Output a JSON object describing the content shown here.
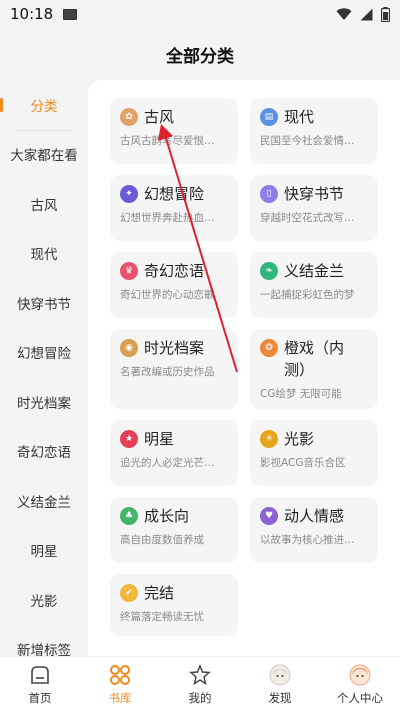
{
  "status_bar": {
    "time": "10:18"
  },
  "page_title": "全部分类",
  "sidebar": {
    "items": [
      {
        "label": "分类",
        "active": true
      },
      {
        "label": "大家都在看"
      },
      {
        "label": "古风"
      },
      {
        "label": "现代"
      },
      {
        "label": "快穿书节"
      },
      {
        "label": "幻想冒险"
      },
      {
        "label": "时光档案"
      },
      {
        "label": "奇幻恋语"
      },
      {
        "label": "义结金兰"
      },
      {
        "label": "明星"
      },
      {
        "label": "光影"
      },
      {
        "label": "新增标签"
      }
    ]
  },
  "categories": [
    {
      "title": "古风",
      "desc": "古风古韵写尽爱恨…",
      "icon": "lotus-icon",
      "color": "#e0a36a"
    },
    {
      "title": "现代",
      "desc": "民国至今社会爱情…",
      "icon": "building-icon",
      "color": "#5b8fe6"
    },
    {
      "title": "幻想冒险",
      "desc": "幻想世界奔赴热血…",
      "icon": "galaxy-icon",
      "color": "#6a5bd6"
    },
    {
      "title": "快穿书节",
      "desc": "穿越时空花式改写…",
      "icon": "book-icon",
      "color": "#8f7fe8"
    },
    {
      "title": "奇幻恋语",
      "desc": "奇幻世界的心动恋歌",
      "icon": "crown-icon",
      "color": "#e8526d"
    },
    {
      "title": "义结金兰",
      "desc": "一起捕捉彩虹色的梦",
      "icon": "leaf-icon",
      "color": "#2fb67a"
    },
    {
      "title": "时光档案",
      "desc": "名著改编或历史作品",
      "icon": "archive-icon",
      "color": "#d9a052"
    },
    {
      "title": "橙戏（内测）",
      "desc": "CG绘梦 无限可能",
      "icon": "film-icon",
      "color": "#f0883a"
    },
    {
      "title": "明星",
      "desc": "追光的人必定光芒…",
      "icon": "star-person-icon",
      "color": "#e4405a"
    },
    {
      "title": "光影",
      "desc": "影视ACG音乐合区",
      "icon": "spotlight-icon",
      "color": "#e6a41c"
    },
    {
      "title": "成长向",
      "desc": "高自由度数值养成",
      "icon": "sprout-icon",
      "color": "#45b56a"
    },
    {
      "title": "动人情感",
      "desc": "以故事为核心推进…",
      "icon": "heart-icon",
      "color": "#8a63d2"
    },
    {
      "title": "完结",
      "desc": "终篇落定畅读无忧",
      "icon": "check-book-icon",
      "color": "#f2b83a"
    }
  ],
  "bottom_nav": [
    {
      "label": "首页",
      "icon": "home-icon"
    },
    {
      "label": "书库",
      "icon": "library-grid-icon",
      "active": true
    },
    {
      "label": "我的",
      "icon": "profile-star-icon"
    },
    {
      "label": "发现",
      "icon": "discover-avatar-icon"
    },
    {
      "label": "个人中心",
      "icon": "user-center-avatar-icon"
    }
  ],
  "colors": {
    "accent": "#f08a1c",
    "background": "#f4f4f4",
    "annotation": "#e0202a"
  }
}
